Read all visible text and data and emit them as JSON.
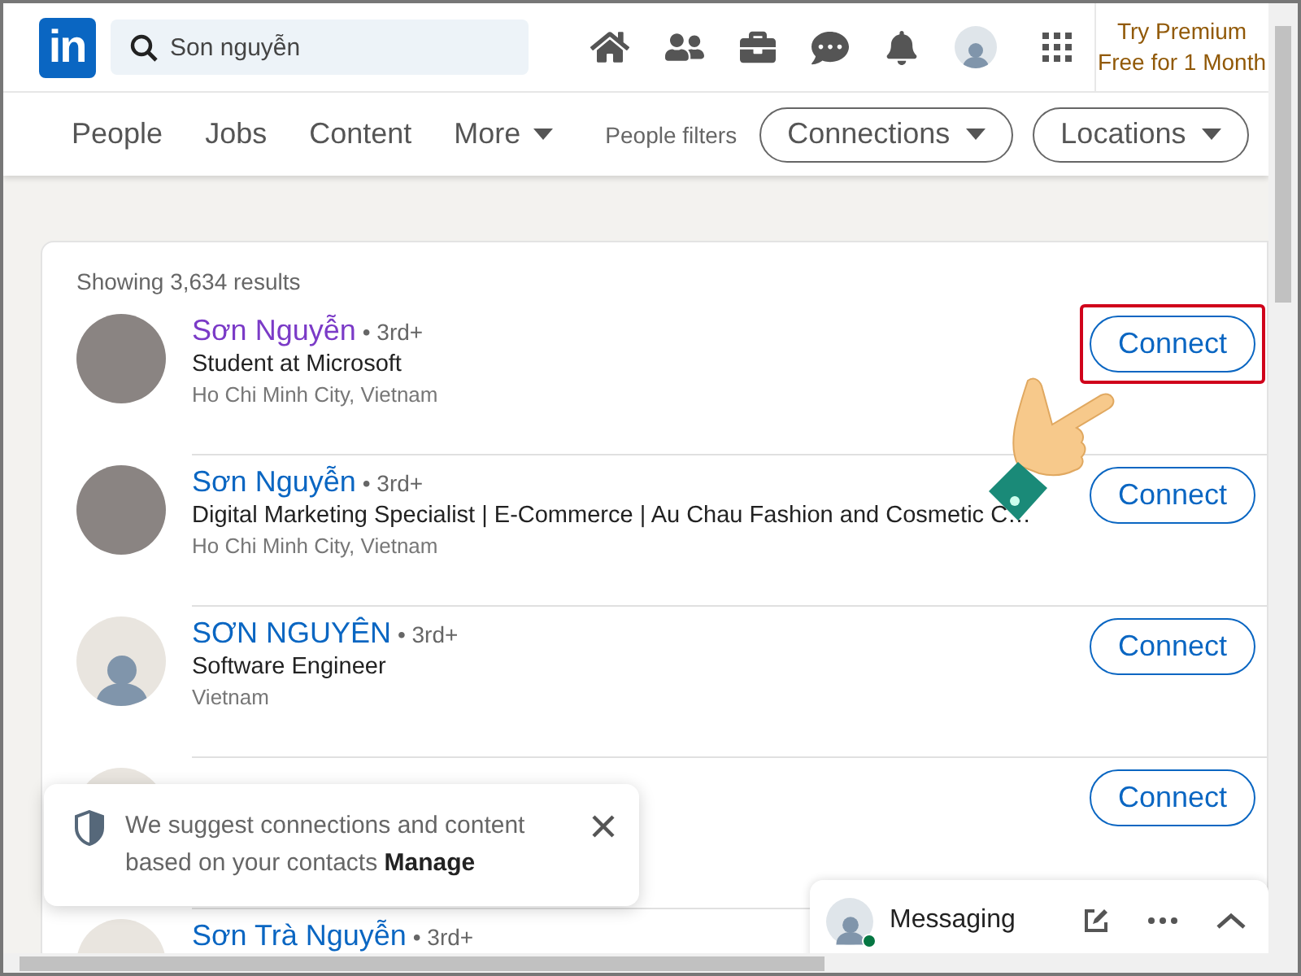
{
  "header": {
    "logo": "in",
    "search": {
      "value": "Son nguyễn"
    },
    "premium": "Try Premium Free for 1 Month"
  },
  "filters": {
    "tabs": [
      {
        "label": "People",
        "dropdown": false
      },
      {
        "label": "Jobs",
        "dropdown": false
      },
      {
        "label": "Content",
        "dropdown": false
      },
      {
        "label": "More",
        "dropdown": true
      }
    ],
    "label": "People filters",
    "pills": [
      "Connections",
      "Locations"
    ]
  },
  "results": {
    "count": "Showing 3,634 results",
    "rows": [
      {
        "avatar": {
          "kind": "photo"
        },
        "name": "Sơn Nguyễn",
        "visited": true,
        "degree": "• 3rd+",
        "headline": "Student at Microsoft",
        "location": "Ho Chi Minh City, Vietnam",
        "button": "Connect",
        "highlighted": true
      },
      {
        "avatar": {
          "kind": "photo"
        },
        "name": "Sơn Nguyễn",
        "visited": false,
        "degree": "• 3rd+",
        "headline": "Digital Marketing Specialist | E-Commerce | Au Chau Fashion and Cosmetic C…",
        "location": "Ho Chi Minh City, Vietnam",
        "button": "Connect",
        "highlighted": false
      },
      {
        "avatar": {
          "kind": "silhouette"
        },
        "name": "SƠN NGUYÊN",
        "visited": false,
        "degree": "• 3rd+",
        "headline": "Software Engineer",
        "location": "Vietnam",
        "button": "Connect",
        "highlighted": false
      },
      {
        "avatar": {
          "kind": "silhouette"
        },
        "button": "Connect",
        "highlighted": false
      },
      {
        "avatar": {
          "kind": "silhouette"
        },
        "name": "Sơn Trà Nguyễn",
        "visited": false,
        "degree": "• 3rd+"
      }
    ]
  },
  "toast": {
    "text": "We suggest connections and content based on your contacts",
    "link": "Manage"
  },
  "messaging": {
    "title": "Messaging",
    "online": true
  }
}
